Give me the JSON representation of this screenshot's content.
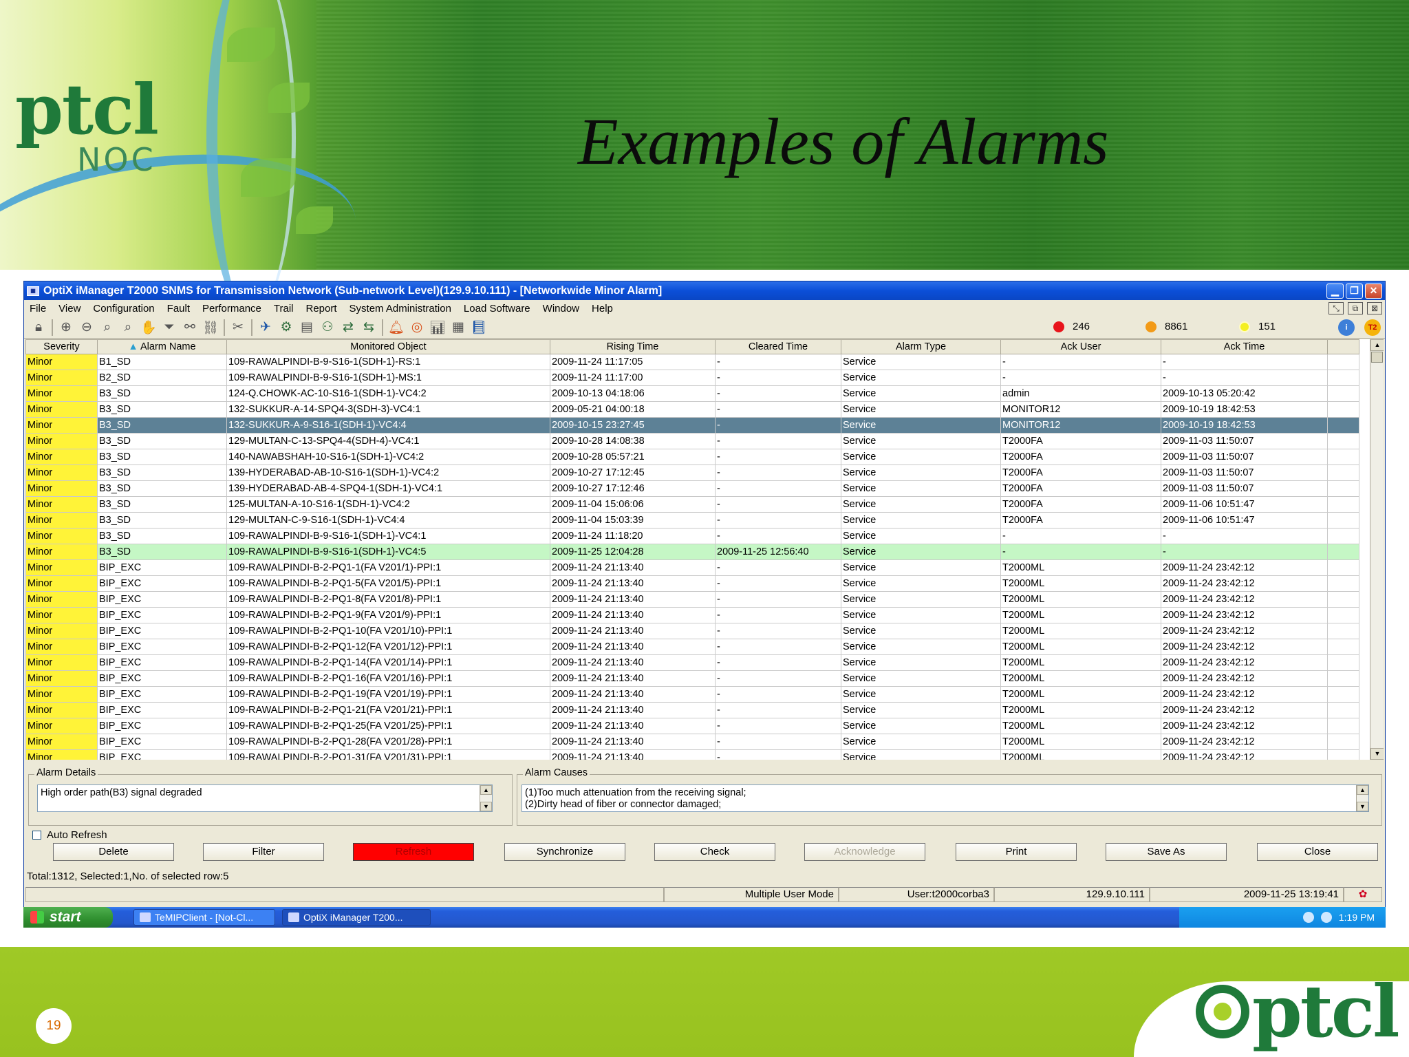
{
  "slide": {
    "title": "Examples of Alarms",
    "logo_main": "ptcl",
    "logo_sub": "NOC",
    "footer_logo": "ptcl",
    "page_number": "19"
  },
  "window": {
    "title": "OptiX iManager T2000 SNMS for Transmission Network (Sub-network Level)(129.9.10.111) - [Networkwide Minor Alarm]",
    "controls": [
      "minimize",
      "restore",
      "close"
    ]
  },
  "menu": [
    {
      "label": "File",
      "underline": "F"
    },
    {
      "label": "View",
      "underline": "V"
    },
    {
      "label": "Configuration",
      "underline": "C"
    },
    {
      "label": "Fault",
      "underline": "l"
    },
    {
      "label": "Performance",
      "underline": "P"
    },
    {
      "label": "Trail",
      "underline": "T"
    },
    {
      "label": "Report",
      "underline": "R"
    },
    {
      "label": "System Administration",
      "underline": "A"
    },
    {
      "label": "Load Software",
      "underline": "f"
    },
    {
      "label": "Window",
      "underline": "W"
    },
    {
      "label": "Help",
      "underline": "H"
    }
  ],
  "alarm_counts": [
    {
      "value": "246",
      "color": "#e8141b"
    },
    {
      "value": "8861",
      "color": "#f29a17"
    },
    {
      "value": "151",
      "color": "#f4ef22"
    }
  ],
  "table": {
    "columns": [
      "Severity",
      "Alarm Name",
      "Monitored Object",
      "Rising Time",
      "Cleared Time",
      "Alarm Type",
      "Ack User",
      "Ack Time"
    ],
    "rows": [
      [
        "Minor",
        "B1_SD",
        "109-RAWALPINDI-B-9-S16-1(SDH-1)-RS:1",
        "2009-11-24 11:17:05",
        "-",
        "Service",
        "-",
        "-"
      ],
      [
        "Minor",
        "B2_SD",
        "109-RAWALPINDI-B-9-S16-1(SDH-1)-MS:1",
        "2009-11-24 11:17:00",
        "-",
        "Service",
        "-",
        "-"
      ],
      [
        "Minor",
        "B3_SD",
        "124-Q.CHOWK-AC-10-S16-1(SDH-1)-VC4:2",
        "2009-10-13 04:18:06",
        "-",
        "Service",
        "admin",
        "2009-10-13 05:20:42"
      ],
      [
        "Minor",
        "B3_SD",
        "132-SUKKUR-A-14-SPQ4-3(SDH-3)-VC4:1",
        "2009-05-21 04:00:18",
        "-",
        "Service",
        "MONITOR12",
        "2009-10-19 18:42:53"
      ],
      [
        "Minor",
        "B3_SD",
        "132-SUKKUR-A-9-S16-1(SDH-1)-VC4:4",
        "2009-10-15 23:27:45",
        "-",
        "Service",
        "MONITOR12",
        "2009-10-19 18:42:53"
      ],
      [
        "Minor",
        "B3_SD",
        "129-MULTAN-C-13-SPQ4-4(SDH-4)-VC4:1",
        "2009-10-28 14:08:38",
        "-",
        "Service",
        "T2000FA",
        "2009-11-03 11:50:07"
      ],
      [
        "Minor",
        "B3_SD",
        "140-NAWABSHAH-10-S16-1(SDH-1)-VC4:2",
        "2009-10-28 05:57:21",
        "-",
        "Service",
        "T2000FA",
        "2009-11-03 11:50:07"
      ],
      [
        "Minor",
        "B3_SD",
        "139-HYDERABAD-AB-10-S16-1(SDH-1)-VC4:2",
        "2009-10-27 17:12:45",
        "-",
        "Service",
        "T2000FA",
        "2009-11-03 11:50:07"
      ],
      [
        "Minor",
        "B3_SD",
        "139-HYDERABAD-AB-4-SPQ4-1(SDH-1)-VC4:1",
        "2009-10-27 17:12:46",
        "-",
        "Service",
        "T2000FA",
        "2009-11-03 11:50:07"
      ],
      [
        "Minor",
        "B3_SD",
        "125-MULTAN-A-10-S16-1(SDH-1)-VC4:2",
        "2009-11-04 15:06:06",
        "-",
        "Service",
        "T2000FA",
        "2009-11-06 10:51:47"
      ],
      [
        "Minor",
        "B3_SD",
        "129-MULTAN-C-9-S16-1(SDH-1)-VC4:4",
        "2009-11-04 15:03:39",
        "-",
        "Service",
        "T2000FA",
        "2009-11-06 10:51:47"
      ],
      [
        "Minor",
        "B3_SD",
        "109-RAWALPINDI-B-9-S16-1(SDH-1)-VC4:1",
        "2009-11-24 11:18:20",
        "-",
        "Service",
        "-",
        "-"
      ],
      [
        "Minor",
        "B3_SD",
        "109-RAWALPINDI-B-9-S16-1(SDH-1)-VC4:5",
        "2009-11-25 12:04:28",
        "2009-11-25 12:56:40",
        "Service",
        "-",
        "-"
      ],
      [
        "Minor",
        "BIP_EXC",
        "109-RAWALPINDI-B-2-PQ1-1(FA V201/1)-PPI:1",
        "2009-11-24 21:13:40",
        "-",
        "Service",
        "T2000ML",
        "2009-11-24 23:42:12"
      ],
      [
        "Minor",
        "BIP_EXC",
        "109-RAWALPINDI-B-2-PQ1-5(FA V201/5)-PPI:1",
        "2009-11-24 21:13:40",
        "-",
        "Service",
        "T2000ML",
        "2009-11-24 23:42:12"
      ],
      [
        "Minor",
        "BIP_EXC",
        "109-RAWALPINDI-B-2-PQ1-8(FA V201/8)-PPI:1",
        "2009-11-24 21:13:40",
        "-",
        "Service",
        "T2000ML",
        "2009-11-24 23:42:12"
      ],
      [
        "Minor",
        "BIP_EXC",
        "109-RAWALPINDI-B-2-PQ1-9(FA V201/9)-PPI:1",
        "2009-11-24 21:13:40",
        "-",
        "Service",
        "T2000ML",
        "2009-11-24 23:42:12"
      ],
      [
        "Minor",
        "BIP_EXC",
        "109-RAWALPINDI-B-2-PQ1-10(FA V201/10)-PPI:1",
        "2009-11-24 21:13:40",
        "-",
        "Service",
        "T2000ML",
        "2009-11-24 23:42:12"
      ],
      [
        "Minor",
        "BIP_EXC",
        "109-RAWALPINDI-B-2-PQ1-12(FA V201/12)-PPI:1",
        "2009-11-24 21:13:40",
        "-",
        "Service",
        "T2000ML",
        "2009-11-24 23:42:12"
      ],
      [
        "Minor",
        "BIP_EXC",
        "109-RAWALPINDI-B-2-PQ1-14(FA V201/14)-PPI:1",
        "2009-11-24 21:13:40",
        "-",
        "Service",
        "T2000ML",
        "2009-11-24 23:42:12"
      ],
      [
        "Minor",
        "BIP_EXC",
        "109-RAWALPINDI-B-2-PQ1-16(FA V201/16)-PPI:1",
        "2009-11-24 21:13:40",
        "-",
        "Service",
        "T2000ML",
        "2009-11-24 23:42:12"
      ],
      [
        "Minor",
        "BIP_EXC",
        "109-RAWALPINDI-B-2-PQ1-19(FA V201/19)-PPI:1",
        "2009-11-24 21:13:40",
        "-",
        "Service",
        "T2000ML",
        "2009-11-24 23:42:12"
      ],
      [
        "Minor",
        "BIP_EXC",
        "109-RAWALPINDI-B-2-PQ1-21(FA V201/21)-PPI:1",
        "2009-11-24 21:13:40",
        "-",
        "Service",
        "T2000ML",
        "2009-11-24 23:42:12"
      ],
      [
        "Minor",
        "BIP_EXC",
        "109-RAWALPINDI-B-2-PQ1-25(FA V201/25)-PPI:1",
        "2009-11-24 21:13:40",
        "-",
        "Service",
        "T2000ML",
        "2009-11-24 23:42:12"
      ],
      [
        "Minor",
        "BIP_EXC",
        "109-RAWALPINDI-B-2-PQ1-28(FA V201/28)-PPI:1",
        "2009-11-24 21:13:40",
        "-",
        "Service",
        "T2000ML",
        "2009-11-24 23:42:12"
      ],
      [
        "Minor",
        "BIP_EXC",
        "109-RAWALPINDI-B-2-PQ1-31(FA V201/31)-PPI:1",
        "2009-11-24 21:13:40",
        "-",
        "Service",
        "T2000ML",
        "2009-11-24 23:42:12"
      ]
    ],
    "selected_row": 4,
    "cleared_row": 12,
    "severity_color": "#fff338",
    "selected_color": "#5d8196",
    "cleared_color": "#c5f7c5"
  },
  "details": {
    "alarm_details_label": "Alarm Details",
    "alarm_details_text": "High order path(B3) signal degraded",
    "alarm_causes_label": "Alarm Causes",
    "alarm_causes_lines": [
      "(1)Too much attenuation from the receiving signal;",
      "(2)Dirty head of fiber or connector damaged;"
    ]
  },
  "controls": {
    "auto_refresh_label": "Auto Refresh",
    "auto_refresh_checked": false,
    "buttons": [
      {
        "label": "Delete",
        "name": "delete-button"
      },
      {
        "label": "Filter",
        "name": "filter-button"
      },
      {
        "label": "Refresh",
        "name": "refresh-button",
        "style": "red"
      },
      {
        "label": "Synchronize",
        "name": "synchronize-button"
      },
      {
        "label": "Check",
        "name": "check-button"
      },
      {
        "label": "Acknowledge",
        "name": "acknowledge-button",
        "style": "disabled"
      },
      {
        "label": "Print",
        "name": "print-button"
      },
      {
        "label": "Save As",
        "name": "save-as-button"
      },
      {
        "label": "Close",
        "name": "close-button"
      }
    ]
  },
  "totals": "Total:1312, Selected:1,No. of selected row:5",
  "statusbar": {
    "mode": "Multiple User Mode",
    "user": "User:t2000corba3",
    "ip": "129.9.10.111",
    "datetime": "2009-11-25 13:19:41"
  },
  "taskbar": {
    "start_label": "start",
    "tasks": [
      "TeMIPClient - [Not-Cl...",
      "OptiX iManager T200..."
    ],
    "clock": "1:19 PM"
  }
}
